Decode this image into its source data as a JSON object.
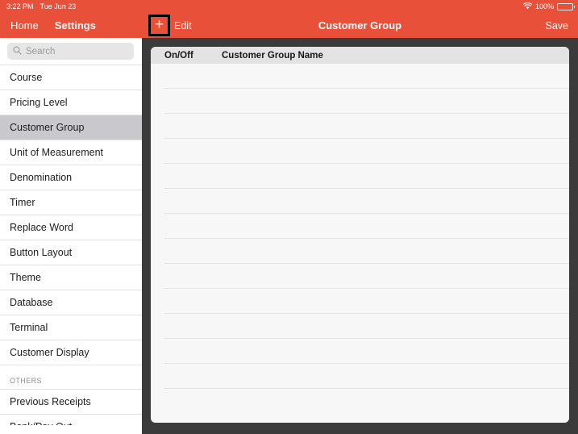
{
  "status_bar": {
    "time": "3:22 PM",
    "date": "Tue Jun 23",
    "wifi_icon": "wifi-icon",
    "battery_percent": "100%",
    "battery_icon": "battery-full-icon"
  },
  "sidebar": {
    "home_label": "Home",
    "title": "Settings",
    "search": {
      "icon": "search-icon",
      "placeholder": "Search",
      "value": ""
    },
    "items": [
      {
        "label": "Course",
        "selected": false
      },
      {
        "label": "Pricing Level",
        "selected": false
      },
      {
        "label": "Customer Group",
        "selected": true
      },
      {
        "label": "Unit of Measurement",
        "selected": false
      },
      {
        "label": "Denomination",
        "selected": false
      },
      {
        "label": "Timer",
        "selected": false
      },
      {
        "label": "Replace Word",
        "selected": false
      },
      {
        "label": "Button Layout",
        "selected": false
      },
      {
        "label": "Theme",
        "selected": false
      },
      {
        "label": "Database",
        "selected": false
      },
      {
        "label": "Terminal",
        "selected": false
      },
      {
        "label": "Customer Display",
        "selected": false
      }
    ],
    "others_section_label": "OTHERS",
    "others_items": [
      {
        "label": "Previous Receipts",
        "selected": false
      },
      {
        "label": "Bank/Pay Out",
        "selected": false
      }
    ]
  },
  "navbar": {
    "add_icon": "plus-icon",
    "add_highlighted": true,
    "edit_label": "Edit",
    "title": "Customer Group",
    "save_label": "Save"
  },
  "table": {
    "columns": [
      "On/Off",
      "Customer Group Name"
    ],
    "rows": [],
    "empty_row_count": 13
  },
  "colors": {
    "accent": "#e8503a",
    "backdrop": "#3b3b3b",
    "panel": "#f7f7f7",
    "header_row": "#e3e3e3",
    "selected_item": "#c9c9cd",
    "highlight_box": "#000000"
  }
}
